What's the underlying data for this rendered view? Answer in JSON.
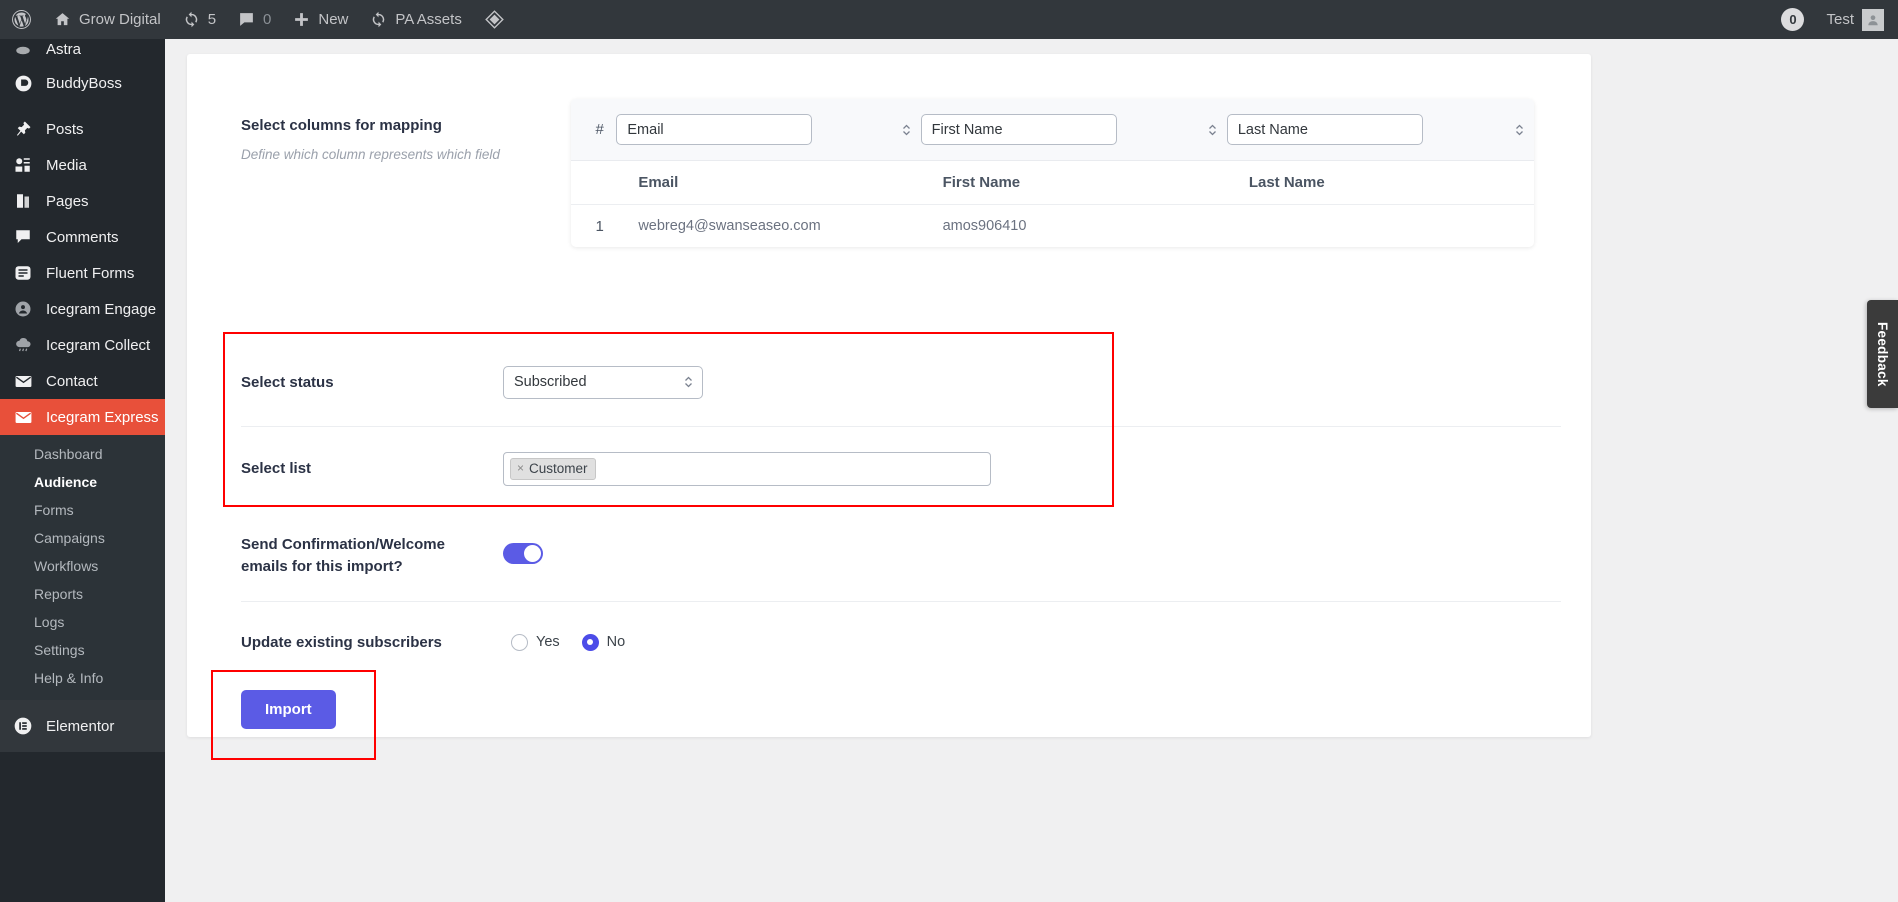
{
  "adminbar": {
    "wp_logo": "wordpress-logo",
    "site_name": "Grow Digital",
    "updates_count": "5",
    "comments_count": "0",
    "new_label": "New",
    "pa_assets_label": "PA Assets",
    "notice_count": "0",
    "user_label": "Test"
  },
  "sidebar": {
    "items": [
      {
        "label": "Astra",
        "icon": "astra-icon",
        "current": false
      },
      {
        "label": "BuddyBoss",
        "icon": "buddyboss-icon",
        "current": false
      },
      {
        "label": "Posts",
        "icon": "pin-icon",
        "current": false
      },
      {
        "label": "Media",
        "icon": "media-icon",
        "current": false
      },
      {
        "label": "Pages",
        "icon": "pages-icon",
        "current": false
      },
      {
        "label": "Comments",
        "icon": "comment-icon",
        "current": false
      },
      {
        "label": "Fluent Forms",
        "icon": "form-icon",
        "current": false
      },
      {
        "label": "Icegram Engage",
        "icon": "user-circle-icon",
        "current": false
      },
      {
        "label": "Icegram Collect",
        "icon": "cloud-rain-icon",
        "current": false
      },
      {
        "label": "Contact",
        "icon": "envelope-icon",
        "current": false
      },
      {
        "label": "Icegram Express",
        "icon": "envelope-icon",
        "current": true
      }
    ],
    "submenu": [
      {
        "label": "Dashboard",
        "active": false
      },
      {
        "label": "Audience",
        "active": true
      },
      {
        "label": "Forms",
        "active": false
      },
      {
        "label": "Campaigns",
        "active": false
      },
      {
        "label": "Workflows",
        "active": false
      },
      {
        "label": "Reports",
        "active": false
      },
      {
        "label": "Logs",
        "active": false
      },
      {
        "label": "Settings",
        "active": false
      },
      {
        "label": "Help & Info",
        "active": false
      }
    ],
    "footer_items": [
      {
        "label": "Elementor",
        "icon": "elementor-icon"
      }
    ]
  },
  "mapping": {
    "title": "Select columns for mapping",
    "subtitle": "Define which column represents which field",
    "hash_header": "#",
    "selects": [
      {
        "value": "Email",
        "name": "column-map-select-1"
      },
      {
        "value": "First Name",
        "name": "column-map-select-2"
      },
      {
        "value": "Last Name",
        "name": "column-map-select-3"
      }
    ],
    "columns": [
      "Email",
      "First Name",
      "Last Name"
    ],
    "rows": [
      {
        "index": "1",
        "cells": [
          "webreg4@swanseaseo.com",
          "amos906410",
          ""
        ]
      }
    ]
  },
  "status_row": {
    "label": "Select status",
    "value": "Subscribed"
  },
  "list_row": {
    "label": "Select list",
    "tags": [
      {
        "label": "Customer",
        "remove": "×"
      }
    ]
  },
  "confirmation_row": {
    "label": "Send Confirmation/Welcome emails for this import?",
    "enabled": true
  },
  "update_row": {
    "label": "Update existing subscribers",
    "options": [
      {
        "label": "Yes",
        "selected": false
      },
      {
        "label": "No",
        "selected": true
      }
    ]
  },
  "actions": {
    "import_label": "Import"
  },
  "feedback": {
    "label": "Feedback"
  },
  "colors": {
    "accent": "#5b5be5",
    "highlight": "#ff0000",
    "current_menu": "#e8503a"
  }
}
